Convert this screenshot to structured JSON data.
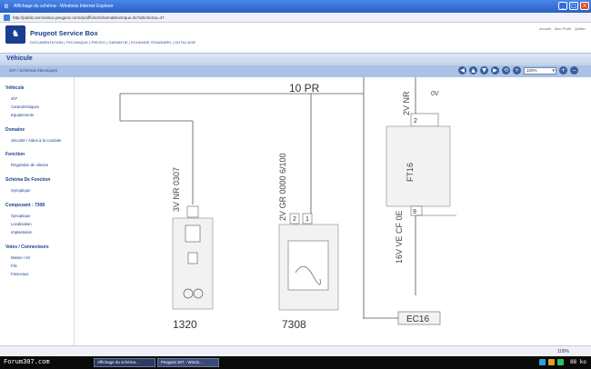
{
  "window": {
    "title": "Affichage du schéma - Windows Internet Explorer",
    "url": "http://public.servicebox.peugeot.com/do/afficheSchemaElectrique.do?idSchema=47"
  },
  "header": {
    "brand": "Peugeot Service Box",
    "nav": "DOCUMENTATION | TECHNIQUE | PIECES | GARANTIE | ECHANGE STANDARD | OUTILLAGE",
    "links": [
      "Accueil",
      "Mon Profil",
      "Quitter"
    ]
  },
  "section": {
    "title": "Véhicule",
    "breadcrumb": "407 / Schémas électriques"
  },
  "toolbar": {
    "buttons": [
      "◀",
      "▲",
      "▼",
      "▶",
      "⟲",
      "+"
    ],
    "zoom_value": "100%",
    "zoom_buttons": [
      "+",
      "−"
    ]
  },
  "sidebar": {
    "sections": [
      {
        "title": "Véhicule",
        "items": [
          "407",
          "Caractéristiques",
          "Equipements"
        ]
      },
      {
        "title": "Domaine",
        "items": [
          "Sécurité / Aides à la conduite"
        ]
      },
      {
        "title": "Fonction",
        "items": [
          "Régulation de vitesse"
        ]
      },
      {
        "title": "Schéma De Fonction",
        "items": [
          "Synoptique"
        ]
      },
      {
        "title": "Composant : 7308",
        "items": [
          "Synoptique",
          "Localisation",
          "Implantation"
        ]
      },
      {
        "title": "Voies / Connecteurs",
        "items": [
          "Masse / 6V",
          "Fils",
          "Faisceaux"
        ]
      }
    ]
  },
  "diagram": {
    "wire_top_label": "10 PR",
    "labels": {
      "left_connector": "3V NR 0307",
      "mid_connector": "2V GR 0000 6/100",
      "right_top": "2V NR",
      "right_inner": "FT16",
      "right_bottom": "16V VE CF 0E",
      "pin_2": "2",
      "pin_1": "1",
      "pin_2b": "2",
      "pin_9": "9",
      "pin_top_right": "0V"
    },
    "components": [
      "1320",
      "7308"
    ],
    "connector_box": "EC16"
  },
  "statusbar": {
    "zoom": "100%"
  },
  "taskbar": {
    "left_text": "Forum307.com",
    "tasks": [
      "Affichage du schéma...",
      "Peugeot 307 - Windo..."
    ],
    "right_text": "88 ko"
  },
  "colors": {
    "brand_blue": "#1a3e8f",
    "section_blue": "#a9c2e6",
    "titlebar_blue": "#2a5fc6"
  }
}
